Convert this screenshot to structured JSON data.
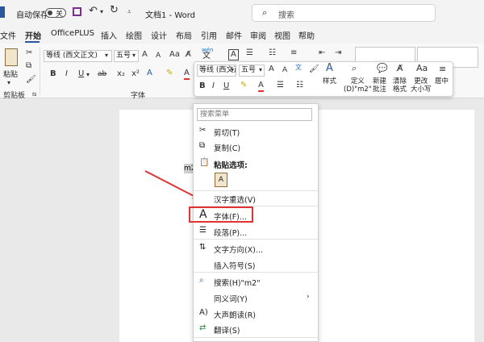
{
  "titlebar": {
    "autosave_label": "自动保存",
    "autosave_state": "关",
    "doc_title": "文档1 - Word",
    "search_placeholder": "搜索"
  },
  "tabs": [
    "文件",
    "开始",
    "OfficePLUS",
    "插入",
    "绘图",
    "设计",
    "布局",
    "引用",
    "邮件",
    "审阅",
    "视图",
    "帮助"
  ],
  "ribbon": {
    "paste_label": "粘贴",
    "clipboard_group": "剪贴板",
    "font_name": "等线 (西文正文)",
    "font_size": "五号",
    "font_group": "字体",
    "font_size_grow": "A",
    "font_size_shrink": "A",
    "change_case": "Aa",
    "wen_label": "wén",
    "wen_char": "文",
    "boxed_a": "A",
    "bold": "B",
    "italic": "I",
    "underline": "U",
    "strike": "ab",
    "subscript": "x₂",
    "superscript": "x²"
  },
  "mini_toolbar": {
    "font_name": "等线 (西文正",
    "font_size": "五号",
    "bold": "B",
    "italic": "I",
    "underline": "U",
    "style_label": "样式",
    "define_label": "定义\n(D)\"m2\"",
    "new_comment_label": "新建\n批注",
    "clear_format_label": "清除\n格式",
    "change_case_label": "更改\n大小写",
    "center_label": "居中"
  },
  "document": {
    "selected_text": "m2"
  },
  "context_menu": {
    "search_placeholder": "搜索菜单",
    "items": {
      "cut": "剪切(T)",
      "copy": "复制(C)",
      "paste_options": "粘贴选项:",
      "hanzi_reselect": "汉字重选(V)",
      "font": "字体(F)...",
      "paragraph": "段落(P)...",
      "text_direction": "文字方向(X)...",
      "insert_symbol": "插入符号(S)",
      "search": "搜索(H)\"m2\"",
      "synonyms": "同义词(Y)",
      "read_aloud": "大声朗读(R)",
      "translate": "翻译(S)"
    }
  },
  "colors": {
    "accent": "#2b579a",
    "highlight_box": "#e03434",
    "arrow": "#e03434"
  }
}
